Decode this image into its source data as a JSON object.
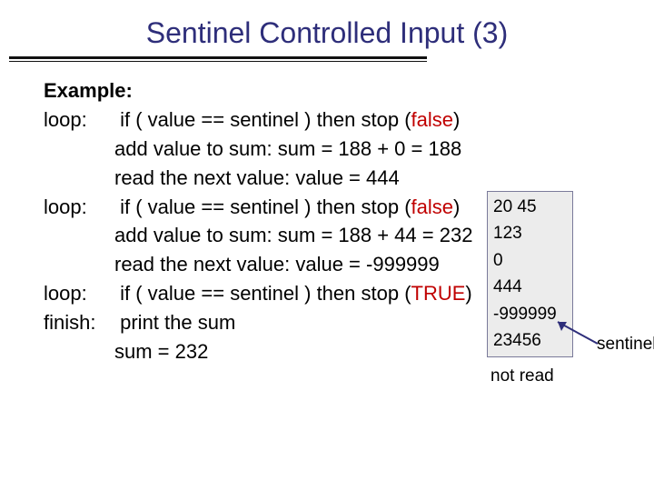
{
  "title": "Sentinel Controlled Input (3)",
  "example_label": "Example:",
  "loop1": {
    "label": "loop:",
    "cond": "if ( value == sentinel ) then stop  (",
    "cond_result": "false",
    "cond_tail": ")",
    "add": "add value to sum:  sum = 188 + 0 = 188",
    "read": "read the next value:  value = 444"
  },
  "loop2": {
    "label": "loop:",
    "cond": "if ( value == sentinel ) then stop (",
    "cond_result": "false",
    "cond_tail": ")",
    "add": "add value to sum:  sum = 188 + 44 = 232",
    "read": "read the next value:  value = -999999"
  },
  "loop3": {
    "label": "loop:",
    "cond": "if ( value == sentinel ) then stop (",
    "cond_result": "TRUE",
    "cond_tail": ")"
  },
  "finish": {
    "label": "finish:",
    "text": "print the sum",
    "sum": "sum = 232"
  },
  "sidebox": {
    "r1": "20  45",
    "r2": "123",
    "r3": "0",
    "r4": "444",
    "r5": "-999999",
    "r6": "23456"
  },
  "notread": "not read",
  "sentinel_label": "sentinel"
}
